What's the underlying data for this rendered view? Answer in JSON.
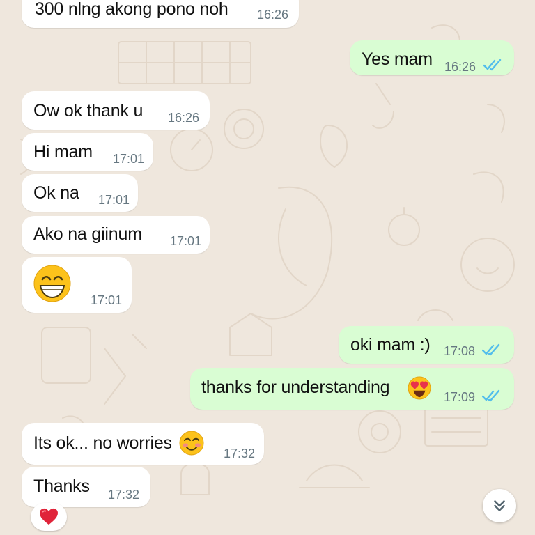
{
  "chat": {
    "messages": [
      {
        "id": "m1",
        "direction": "incoming",
        "text": "300 nlng akong pono noh",
        "time": "16:26"
      },
      {
        "id": "m2",
        "direction": "outgoing",
        "text": "Yes mam",
        "time": "16:26",
        "status": "read"
      },
      {
        "id": "m3",
        "direction": "incoming",
        "text": "Ow ok thank u",
        "time": "16:26"
      },
      {
        "id": "m4",
        "direction": "incoming",
        "text": "Hi mam",
        "time": "17:01"
      },
      {
        "id": "m5",
        "direction": "incoming",
        "text": "Ok na",
        "time": "17:01"
      },
      {
        "id": "m6",
        "direction": "incoming",
        "text": "Ako  na giinum",
        "time": "17:01"
      },
      {
        "id": "m7",
        "direction": "incoming",
        "emoji": "grinning-face-emoji",
        "time": "17:01"
      },
      {
        "id": "m8",
        "direction": "outgoing",
        "text": "oki mam :)",
        "time": "17:08",
        "status": "read"
      },
      {
        "id": "m9",
        "direction": "outgoing",
        "text": "thanks for understanding",
        "emoji": "heart-eyes-emoji",
        "time": "17:09",
        "status": "read"
      },
      {
        "id": "m10",
        "direction": "incoming",
        "text": "Its ok... no worries",
        "emoji": "smiling-blush-emoji",
        "time": "17:32"
      },
      {
        "id": "m11",
        "direction": "incoming",
        "text": "Thanks",
        "time": "17:32",
        "reaction": "red-heart-emoji"
      }
    ]
  },
  "colors": {
    "background": "#efe7dd",
    "incoming_bubble": "#ffffff",
    "outgoing_bubble": "#d9fdd3",
    "timestamp": "#667781",
    "read_ticks": "#53bdeb"
  },
  "icons": {
    "read_receipt": "double-check-icon",
    "scroll_down": "double-chevron-down-icon"
  }
}
